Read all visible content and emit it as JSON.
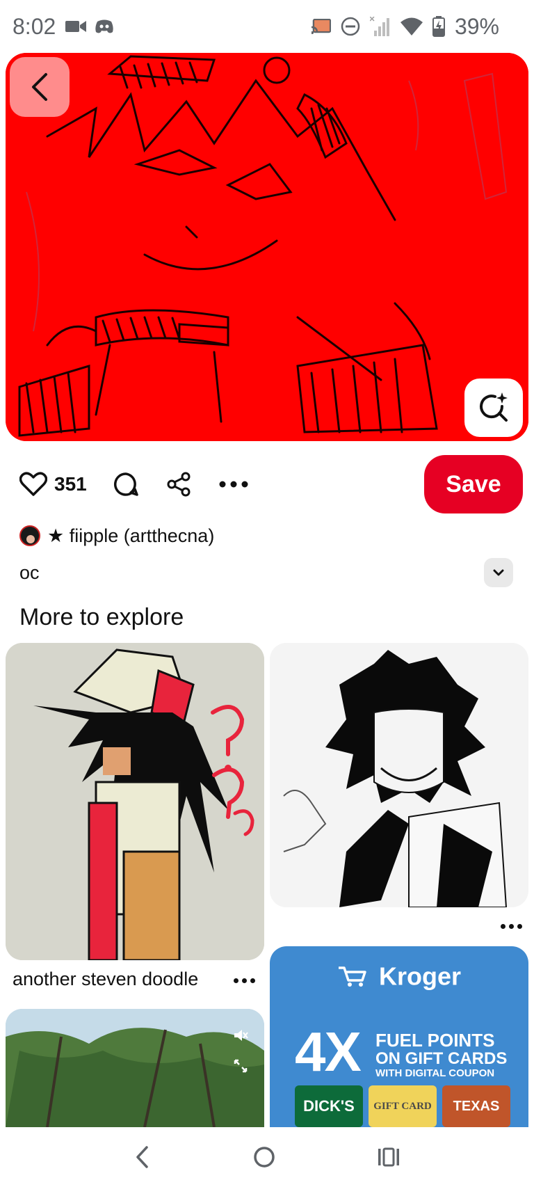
{
  "status_bar": {
    "time": "8:02",
    "battery_text": "39%",
    "icons": [
      "video-camera-icon",
      "discord-icon",
      "cast-icon",
      "do-not-disturb-icon",
      "no-signal-icon",
      "wifi-icon",
      "battery-charging-icon"
    ]
  },
  "pin": {
    "like_count": "351",
    "save_label": "Save",
    "author_name": "★ fiipple (artthecna)",
    "title": "oc",
    "accent_color": "#e60023",
    "image_background": "#ff0000"
  },
  "explore": {
    "heading": "More to explore",
    "cards": [
      {
        "caption": "another steven doodle"
      },
      {
        "caption": ""
      },
      {
        "caption": ""
      },
      {
        "ad_brand": "Kroger",
        "ad_headline": "4X",
        "ad_line1": "FUEL POINTS",
        "ad_line2": "ON GIFT CARDS",
        "ad_line3": "WITH DIGITAL COUPON",
        "gift_cards": [
          "DICK'S",
          "GIFT CARD",
          "TEXAS"
        ]
      }
    ]
  },
  "nav": {
    "icons": [
      "back-icon",
      "home-icon",
      "recents-icon"
    ]
  }
}
